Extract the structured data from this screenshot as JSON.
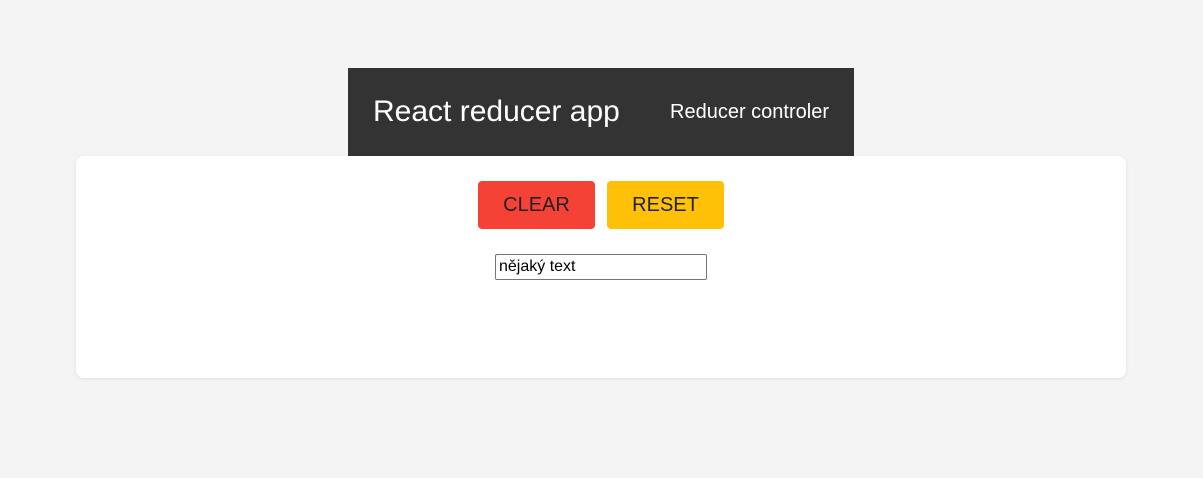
{
  "header": {
    "title": "React reducer app",
    "nav_link": "Reducer controler"
  },
  "controls": {
    "clear_label": "CLEAR",
    "reset_label": "RESET",
    "clear_color": "#f44336",
    "reset_color": "#ffc107"
  },
  "input": {
    "value": "nějaký text"
  },
  "colors": {
    "background": "#f4f4f4",
    "header": "#333333",
    "card": "#ffffff"
  }
}
